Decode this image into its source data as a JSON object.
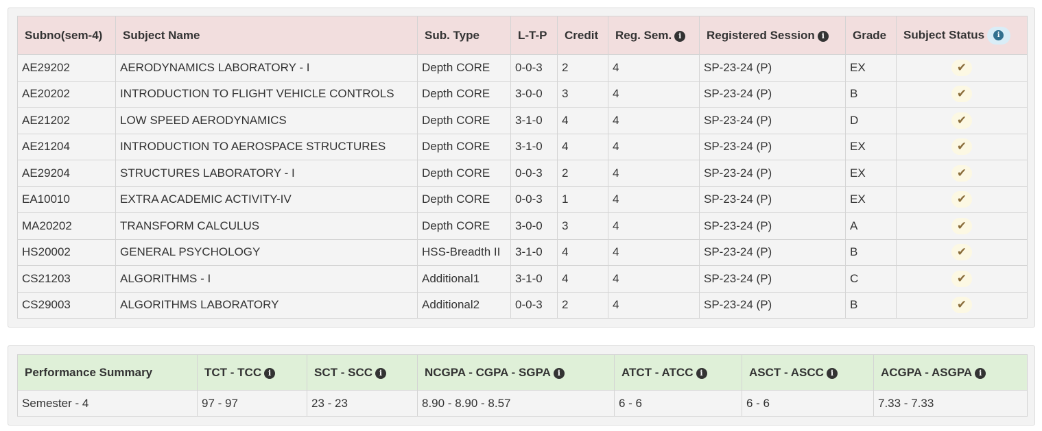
{
  "subjects": {
    "headers": {
      "subno": "Subno(sem-4)",
      "name": "Subject Name",
      "type": "Sub. Type",
      "ltp": "L-T-P",
      "credit": "Credit",
      "reg_sem": "Reg. Sem.",
      "session": "Registered Session",
      "grade": "Grade",
      "status": "Subject Status"
    },
    "rows": [
      {
        "subno": "AE29202",
        "name": "AERODYNAMICS LABORATORY - I",
        "type": "Depth CORE",
        "ltp": "0-0-3",
        "credit": "2",
        "reg_sem": "4",
        "session": "SP-23-24 (P)",
        "grade": "EX",
        "status": "check-icon"
      },
      {
        "subno": "AE20202",
        "name": "INTRODUCTION TO FLIGHT VEHICLE CONTROLS",
        "type": "Depth CORE",
        "ltp": "3-0-0",
        "credit": "3",
        "reg_sem": "4",
        "session": "SP-23-24 (P)",
        "grade": "B",
        "status": "check-icon"
      },
      {
        "subno": "AE21202",
        "name": "LOW SPEED AERODYNAMICS",
        "type": "Depth CORE",
        "ltp": "3-1-0",
        "credit": "4",
        "reg_sem": "4",
        "session": "SP-23-24 (P)",
        "grade": "D",
        "status": "check-icon"
      },
      {
        "subno": "AE21204",
        "name": "INTRODUCTION TO AEROSPACE STRUCTURES",
        "type": "Depth CORE",
        "ltp": "3-1-0",
        "credit": "4",
        "reg_sem": "4",
        "session": "SP-23-24 (P)",
        "grade": "EX",
        "status": "check-icon"
      },
      {
        "subno": "AE29204",
        "name": "STRUCTURES LABORATORY - I",
        "type": "Depth CORE",
        "ltp": "0-0-3",
        "credit": "2",
        "reg_sem": "4",
        "session": "SP-23-24 (P)",
        "grade": "EX",
        "status": "check-icon"
      },
      {
        "subno": "EA10010",
        "name": "EXTRA ACADEMIC ACTIVITY-IV",
        "type": "Depth CORE",
        "ltp": "0-0-3",
        "credit": "1",
        "reg_sem": "4",
        "session": "SP-23-24 (P)",
        "grade": "EX",
        "status": "check-icon"
      },
      {
        "subno": "MA20202",
        "name": "TRANSFORM CALCULUS",
        "type": "Depth CORE",
        "ltp": "3-0-0",
        "credit": "3",
        "reg_sem": "4",
        "session": "SP-23-24 (P)",
        "grade": "A",
        "status": "check-icon"
      },
      {
        "subno": "HS20002",
        "name": "GENERAL PSYCHOLOGY",
        "type": "HSS-Breadth II",
        "ltp": "3-1-0",
        "credit": "4",
        "reg_sem": "4",
        "session": "SP-23-24 (P)",
        "grade": "B",
        "status": "check-icon"
      },
      {
        "subno": "CS21203",
        "name": "ALGORITHMS - I",
        "type": "Additional1",
        "ltp": "3-1-0",
        "credit": "4",
        "reg_sem": "4",
        "session": "SP-23-24 (P)",
        "grade": "C",
        "status": "check-icon"
      },
      {
        "subno": "CS29003",
        "name": "ALGORITHMS LABORATORY",
        "type": "Additional2",
        "ltp": "0-0-3",
        "credit": "2",
        "reg_sem": "4",
        "session": "SP-23-24 (P)",
        "grade": "B",
        "status": "check-icon"
      }
    ]
  },
  "summary": {
    "headers": {
      "perf": "Performance Summary",
      "tct": "TCT - TCC",
      "sct": "SCT - SCC",
      "ncgpa": "NCGPA - CGPA - SGPA",
      "atct": "ATCT - ATCC",
      "asct": "ASCT - ASCC",
      "acgpa": "ACGPA - ASGPA"
    },
    "row": {
      "perf": "Semester - 4",
      "tct": "97 - 97",
      "sct": "23 - 23",
      "ncgpa": "8.90 - 8.90 - 8.57",
      "atct": "6 - 6",
      "asct": "6 - 6",
      "acgpa": "7.33 - 7.33"
    }
  },
  "colors": {
    "subjects_header_bg": "#f2dede",
    "summary_header_bg": "#dff0d8",
    "status_badge_bg": "#fcf8e3",
    "check_color": "#8a6d3b",
    "info_badge_bg": "#d9edf7"
  },
  "icons": {
    "info": "info-icon",
    "status": "check-icon"
  }
}
